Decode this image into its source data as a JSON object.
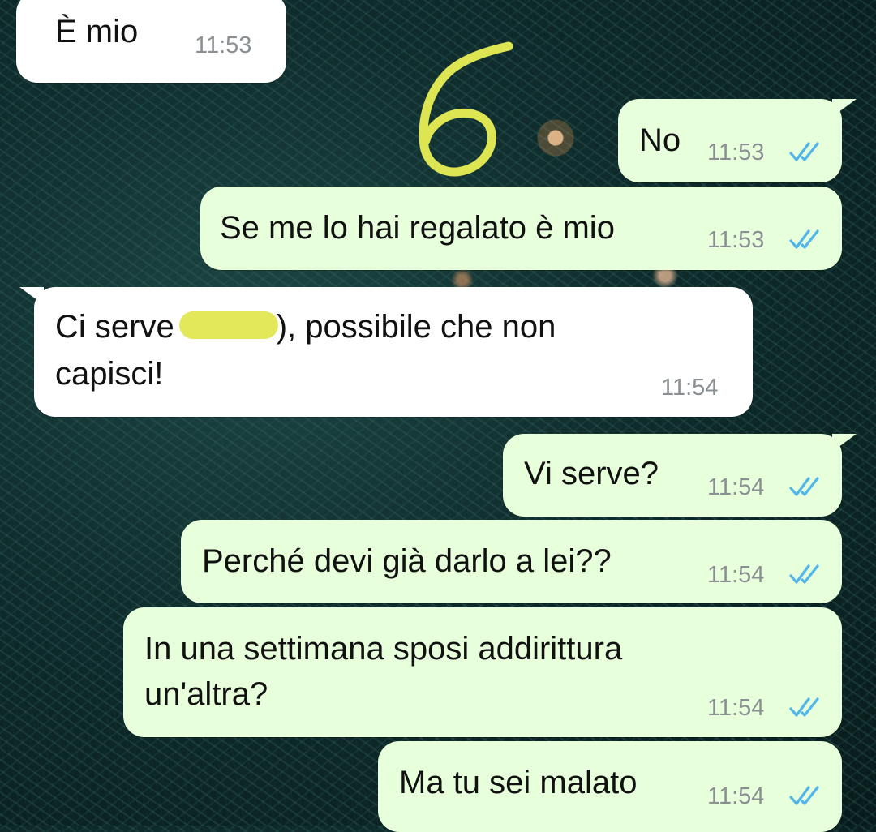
{
  "messages": [
    {
      "dir": "in",
      "text": "È mio",
      "time": "11:53"
    },
    {
      "dir": "out",
      "text": "No",
      "time": "11:53",
      "status": "read-double-check-icon"
    },
    {
      "dir": "out",
      "text": "Se me lo hai regalato è mio",
      "time": "11:53",
      "status": "read-double-check-icon"
    },
    {
      "dir": "in",
      "text_before": "Ci serve",
      "redacted": true,
      "text_after": "),  possibile che non",
      "text_line2": "capisci!",
      "time": "11:54"
    },
    {
      "dir": "out",
      "text": "Vi serve?",
      "time": "11:54",
      "status": "read-double-check-icon"
    },
    {
      "dir": "out",
      "text": "Perché devi già darlo a lei??",
      "time": "11:54",
      "status": "read-double-check-icon"
    },
    {
      "dir": "out",
      "text": "In una settimana sposi addirittura",
      "text_line2": "un'altra?",
      "time": "11:54",
      "status": "read-double-check-icon"
    },
    {
      "dir": "out",
      "text": "Ma tu sei malato",
      "time": "11:54",
      "status": "read-double-check-icon"
    }
  ],
  "annotation": {
    "label": "6",
    "color": "#dde552"
  },
  "colors": {
    "incoming": "#ffffff",
    "outgoing": "#e7ffdb",
    "tick": "#4fb6ec",
    "time": "#8a8f93",
    "redaction": "#e2e85a"
  }
}
